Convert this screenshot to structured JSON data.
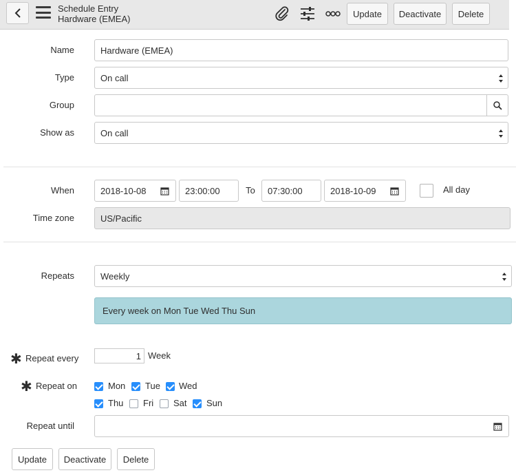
{
  "header": {
    "title": "Schedule Entry",
    "subtitle": "Hardware (EMEA)",
    "icons": [
      "back-icon",
      "menu-icon",
      "paperclip-icon",
      "settings-sliders-icon",
      "more-icon"
    ],
    "buttons": {
      "update": "Update",
      "deactivate": "Deactivate",
      "delete": "Delete"
    }
  },
  "form": {
    "name": {
      "label": "Name",
      "value": "Hardware (EMEA)"
    },
    "type": {
      "label": "Type",
      "value": "On call"
    },
    "group": {
      "label": "Group",
      "value": ""
    },
    "show_as": {
      "label": "Show as",
      "value": "On call"
    },
    "when": {
      "label": "When",
      "start_date": "2018-10-08",
      "start_time": "23:00:00",
      "to_label": "To",
      "end_time": "07:30:00",
      "end_date": "2018-10-09",
      "all_day_label": "All day",
      "all_day_checked": false
    },
    "time_zone": {
      "label": "Time zone",
      "value": "US/Pacific"
    },
    "repeats": {
      "label": "Repeats",
      "value": "Weekly"
    },
    "summary": "Every week on Mon Tue Wed Thu Sun",
    "repeat_every": {
      "label": "Repeat every",
      "value": "1",
      "unit": "Week"
    },
    "repeat_on": {
      "label": "Repeat on",
      "days": [
        {
          "label": "Mon",
          "checked": true
        },
        {
          "label": "Tue",
          "checked": true
        },
        {
          "label": "Wed",
          "checked": true
        },
        {
          "label": "Thu",
          "checked": true
        },
        {
          "label": "Fri",
          "checked": false
        },
        {
          "label": "Sat",
          "checked": false
        },
        {
          "label": "Sun",
          "checked": true
        }
      ]
    },
    "repeat_until": {
      "label": "Repeat until",
      "value": ""
    }
  },
  "footer": {
    "update": "Update",
    "deactivate": "Deactivate",
    "delete": "Delete"
  },
  "colors": {
    "accent": "#278efc",
    "summary_bg": "#abd6dd",
    "header_bg": "#e8e8e8"
  }
}
